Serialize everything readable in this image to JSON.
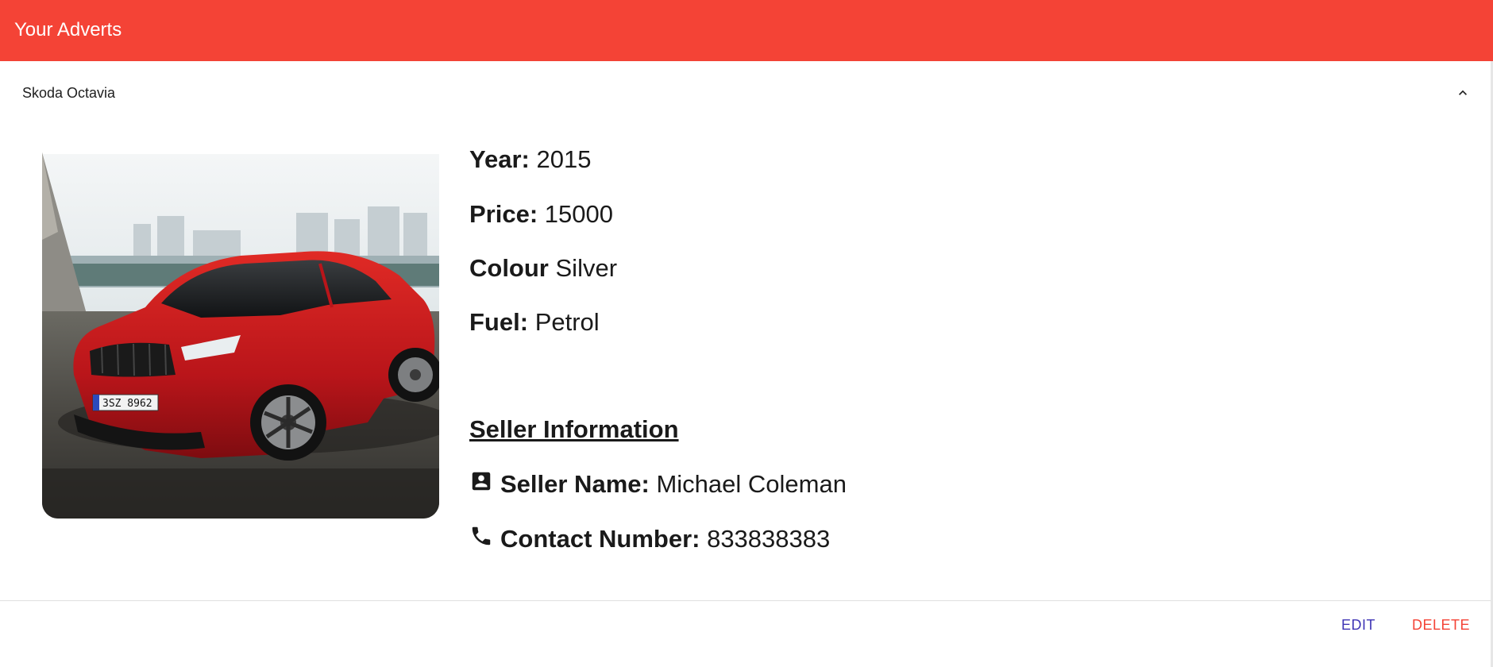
{
  "app_bar": {
    "title": "Your Adverts",
    "color": "#f44336"
  },
  "advert": {
    "title": "Skoda Octavia",
    "image_alt": "car-photo",
    "plate_text": "3SZ 8962",
    "details": [
      {
        "label": "Year:",
        "value": "2015"
      },
      {
        "label": "Price:",
        "value": "15000"
      },
      {
        "label": "Colour",
        "value": "Silver"
      },
      {
        "label": "Fuel:",
        "value": "Petrol"
      }
    ],
    "seller": {
      "heading": "Seller Information",
      "name_label": "Seller Name:",
      "name_value": "Michael Coleman",
      "name_icon": "contact-card-icon",
      "phone_label": "Contact Number:",
      "phone_value": "833838383",
      "phone_icon": "phone-icon"
    },
    "actions": {
      "edit_label": "EDIT",
      "delete_label": "DELETE",
      "edit_color": "#3f35b5",
      "delete_color": "#f44336"
    },
    "collapse_icon": "chevron-up-icon"
  }
}
